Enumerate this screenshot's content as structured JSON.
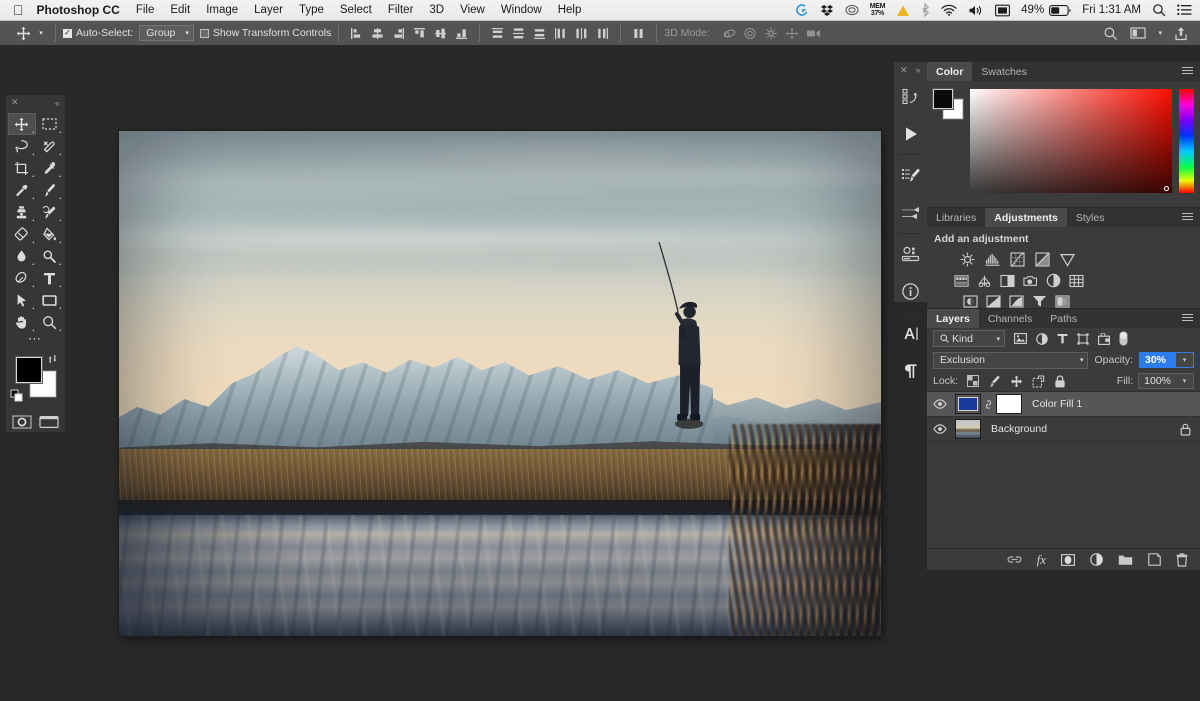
{
  "menubar": {
    "apple_icon": "apple-icon",
    "app_title": "Photoshop CC",
    "items": [
      "File",
      "Edit",
      "Image",
      "Layer",
      "Type",
      "Select",
      "Filter",
      "3D",
      "View",
      "Window",
      "Help"
    ],
    "status_icons": [
      "logitech-g-icon",
      "dropbox-icon",
      "creative-cloud-icon",
      "memory-meter-icon",
      "warning-triangle-icon",
      "bluetooth-icon",
      "wifi-icon",
      "volume-icon",
      "screen-icon",
      "battery-icon",
      "spotlight-search-icon",
      "control-center-icon"
    ],
    "memory_label_top": "MEM",
    "memory_label_bottom": "37%",
    "battery_percent": "49%",
    "clock": "Fri 1:31 AM"
  },
  "options_bar": {
    "tool_icon": "move-tool-icon",
    "tool_preset_caret": "chevron-down-icon",
    "auto_select_label": "Auto-Select:",
    "auto_select_checked": true,
    "auto_select_value": "Group",
    "show_transform_label": "Show Transform Controls",
    "show_transform_checked": false,
    "align_icons": [
      "align-left-edges-icon",
      "align-horizontal-centers-icon",
      "align-right-edges-icon",
      "align-top-edges-icon",
      "align-vertical-centers-icon",
      "align-bottom-edges-icon"
    ],
    "distribute_icons": [
      "distribute-top-edges-icon",
      "distribute-vertical-centers-icon",
      "distribute-bottom-edges-icon",
      "distribute-left-edges-icon",
      "distribute-horizontal-centers-icon",
      "distribute-right-edges-icon"
    ],
    "extra_icon": "distribute-spacing-icon",
    "threed_label": "3D Mode:",
    "threed_icons": [
      "orbit-3d-icon",
      "roll-3d-icon",
      "pan-3d-icon",
      "slide-3d-icon",
      "scale-3d-icon"
    ],
    "right_icons": [
      "search-icon",
      "workspace-icon",
      "chevron-down-icon",
      "share-icon"
    ]
  },
  "toolbar": {
    "close_icon": "close-icon",
    "collapse_icon": "double-chevron-left-icon",
    "tools": [
      {
        "name": "move-tool",
        "icon": "move-icon",
        "selected": true,
        "has_flyout": true
      },
      {
        "name": "rectangular-marquee-tool",
        "icon": "marquee-icon",
        "selected": false,
        "has_flyout": true
      },
      {
        "name": "lasso-tool",
        "icon": "lasso-icon",
        "selected": false,
        "has_flyout": true
      },
      {
        "name": "quick-selection-tool",
        "icon": "quick-select-icon",
        "selected": false,
        "has_flyout": true
      },
      {
        "name": "crop-tool",
        "icon": "crop-icon",
        "selected": false,
        "has_flyout": true
      },
      {
        "name": "eyedropper-tool",
        "icon": "eyedropper-icon",
        "selected": false,
        "has_flyout": true
      },
      {
        "name": "spot-healing-brush-tool",
        "icon": "healing-brush-icon",
        "selected": false,
        "has_flyout": true
      },
      {
        "name": "brush-tool",
        "icon": "brush-icon",
        "selected": false,
        "has_flyout": true
      },
      {
        "name": "clone-stamp-tool",
        "icon": "clone-stamp-icon",
        "selected": false,
        "has_flyout": true
      },
      {
        "name": "history-brush-tool",
        "icon": "history-brush-icon",
        "selected": false,
        "has_flyout": true
      },
      {
        "name": "eraser-tool",
        "icon": "eraser-icon",
        "selected": false,
        "has_flyout": true
      },
      {
        "name": "gradient-tool",
        "icon": "paint-bucket-icon",
        "selected": false,
        "has_flyout": true
      },
      {
        "name": "blur-tool",
        "icon": "blur-drop-icon",
        "selected": false,
        "has_flyout": true
      },
      {
        "name": "dodge-tool",
        "icon": "dodge-icon",
        "selected": false,
        "has_flyout": true
      },
      {
        "name": "pen-tool",
        "icon": "pen-icon",
        "selected": false,
        "has_flyout": true
      },
      {
        "name": "horizontal-type-tool",
        "icon": "type-icon",
        "selected": false,
        "has_flyout": true
      },
      {
        "name": "path-selection-tool",
        "icon": "path-select-arrow-icon",
        "selected": false,
        "has_flyout": true
      },
      {
        "name": "rectangle-tool",
        "icon": "rectangle-shape-icon",
        "selected": false,
        "has_flyout": true
      },
      {
        "name": "hand-tool",
        "icon": "hand-icon",
        "selected": false,
        "has_flyout": true
      },
      {
        "name": "zoom-tool",
        "icon": "magnifier-icon",
        "selected": false,
        "has_flyout": true
      }
    ],
    "edit_toolbar_icon": "ellipsis-icon",
    "foreground_color": "#000000",
    "background_color": "#ffffff",
    "swap_icon": "swap-colors-icon",
    "default_colors_icon": "default-colors-icon",
    "quick_mask_icon": "quick-mask-icon",
    "screen_mode_icon": "screen-mode-icon"
  },
  "document": {
    "title": "fisherman-river-mountains",
    "description": "Photograph of a fly fisherman casting on a riverbank with snow-capped mountains at dusk"
  },
  "dock_strip": {
    "close_icon": "close-icon",
    "expand_icon": "double-chevron-right-icon",
    "icons": [
      "history-icon",
      "actions-play-icon",
      "brush-presets-icon",
      "brush-settings-icon",
      "properties-icon",
      "info-icon",
      "character-icon",
      "paragraph-icon"
    ]
  },
  "panels": {
    "collapse_icon": "double-chevron-right-icon",
    "color_panel": {
      "tabs": [
        {
          "label": "Color",
          "active": true
        },
        {
          "label": "Swatches",
          "active": false
        }
      ],
      "menu_icon": "panel-menu-icon",
      "foreground_color": "#0a0a0a",
      "background_color": "#ffffff",
      "spectrum_name": "color-field",
      "hue_strip_name": "hue-strip"
    },
    "adjustments_panel": {
      "tabs": [
        {
          "label": "Libraries",
          "active": false
        },
        {
          "label": "Adjustments",
          "active": true
        },
        {
          "label": "Styles",
          "active": false
        }
      ],
      "menu_icon": "panel-menu-icon",
      "title": "Add an adjustment",
      "row1": [
        "brightness-contrast-icon",
        "levels-icon",
        "curves-icon",
        "exposure-icon",
        "vibrance-icon"
      ],
      "row2": [
        "hue-saturation-icon",
        "color-balance-icon",
        "black-white-icon",
        "photo-filter-icon",
        "channel-mixer-icon",
        "color-lookup-icon"
      ],
      "row3": [
        "invert-icon",
        "posterize-icon",
        "threshold-icon",
        "selective-color-icon",
        "gradient-map-icon"
      ]
    },
    "layers_panel": {
      "tabs": [
        {
          "label": "Layers",
          "active": true
        },
        {
          "label": "Channels",
          "active": false
        },
        {
          "label": "Paths",
          "active": false
        }
      ],
      "menu_icon": "panel-menu-icon",
      "filter_icon": "search-icon",
      "filter_value": "Kind",
      "filter_caret": "chevron-down-icon",
      "filter_type_icons": [
        "pixel-layer-filter-icon",
        "adjustment-layer-filter-icon",
        "type-layer-filter-icon",
        "shape-layer-filter-icon",
        "smart-object-filter-icon",
        "filter-toggle-icon"
      ],
      "blend_mode": "Exclusion",
      "blend_caret": "chevron-down-icon",
      "opacity_label": "Opacity:",
      "opacity_value": "30%",
      "opacity_selected": true,
      "lock_label": "Lock:",
      "lock_icons": [
        "lock-transparent-pixels-icon",
        "lock-image-pixels-icon",
        "lock-position-icon",
        "lock-artboard-nesting-icon",
        "lock-all-icon"
      ],
      "fill_label": "Fill:",
      "fill_value": "100%",
      "layers": [
        {
          "name": "Color Fill 1",
          "visible": true,
          "selected": true,
          "eye_icon": "eye-icon",
          "thumbnail": "solid-color-thumbnail",
          "thumbnail_color": "#1a3a9e",
          "link_icon": "link-icon",
          "mask_thumbnail": "layer-mask-thumbnail",
          "locked": false
        },
        {
          "name": "Background",
          "visible": true,
          "selected": false,
          "eye_icon": "eye-icon",
          "thumbnail": "photo-thumbnail",
          "locked": true,
          "lock_icon": "lock-icon"
        }
      ],
      "bottom_icons": [
        "link-layers-icon",
        "layer-style-fx-icon",
        "add-layer-mask-icon",
        "new-adjustment-layer-icon",
        "new-group-icon",
        "new-layer-icon",
        "delete-layer-icon"
      ],
      "fx_label": "fx"
    }
  }
}
